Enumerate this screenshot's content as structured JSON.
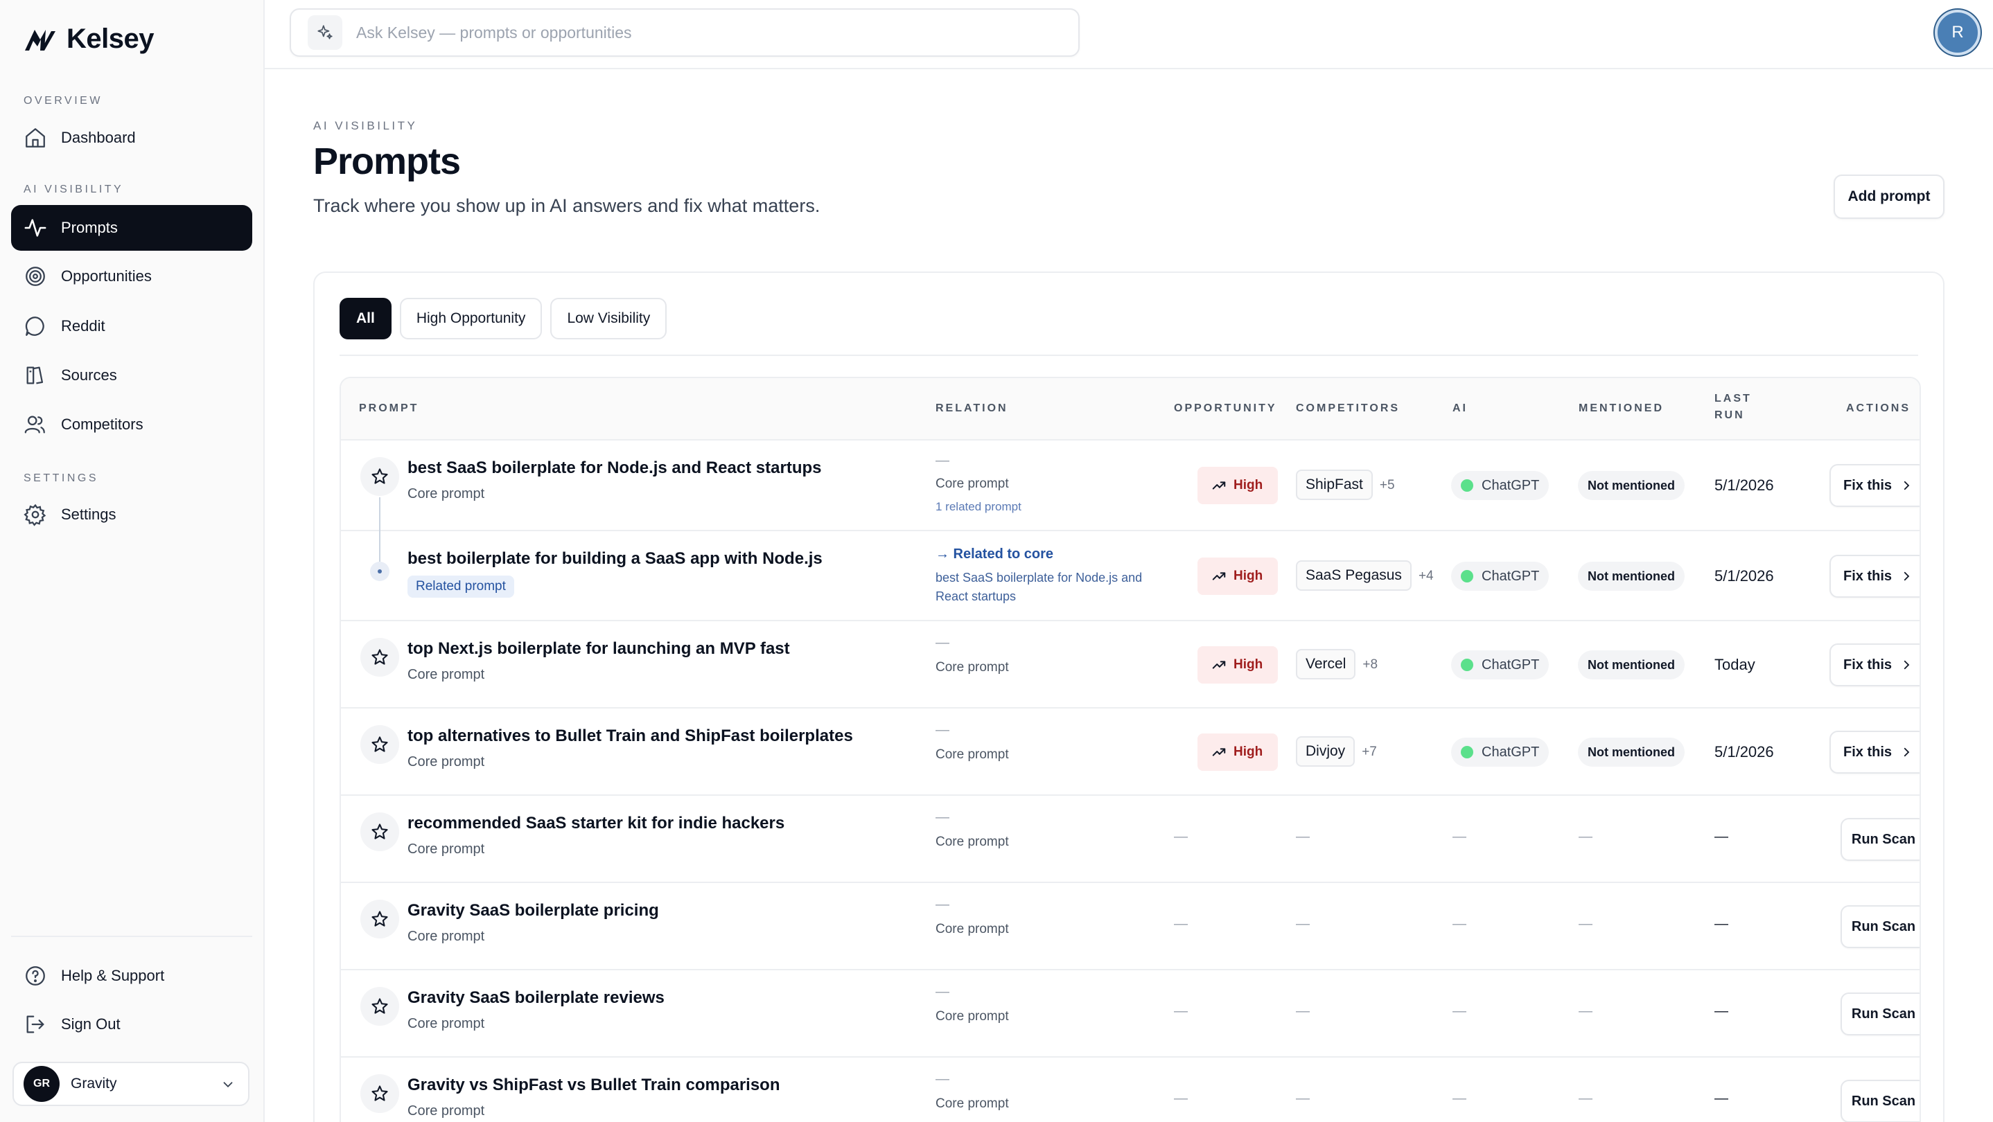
{
  "app": {
    "name": "Kelsey"
  },
  "sidebar": {
    "sections": [
      {
        "label": "OVERVIEW"
      },
      {
        "label": "AI VISIBILITY"
      },
      {
        "label": "SETTINGS"
      }
    ],
    "items": [
      {
        "label": "Dashboard",
        "icon": "home-icon"
      },
      {
        "label": "Prompts",
        "icon": "activity-icon",
        "active": true
      },
      {
        "label": "Opportunities",
        "icon": "target-icon"
      },
      {
        "label": "Reddit",
        "icon": "chat-bubble-icon"
      },
      {
        "label": "Sources",
        "icon": "book-icon"
      },
      {
        "label": "Competitors",
        "icon": "users-icon"
      },
      {
        "label": "Settings",
        "icon": "gear-icon"
      }
    ],
    "footer": [
      {
        "label": "Help & Support",
        "icon": "help-circle-icon"
      },
      {
        "label": "Sign Out",
        "icon": "sign-out-icon"
      }
    ],
    "workspace": {
      "initials": "GR",
      "name": "Gravity"
    }
  },
  "topbar": {
    "search_placeholder": "Ask Kelsey — prompts or opportunities",
    "user_initial": "R"
  },
  "header": {
    "eyebrow": "AI VISIBILITY",
    "title": "Prompts",
    "subtitle": "Track where you show up in AI answers and fix what matters.",
    "add_button": "Add prompt"
  },
  "tabs": [
    "All",
    "High Opportunity",
    "Low Visibility"
  ],
  "table": {
    "columns": {
      "prompt": "PROMPT",
      "relation": "RELATION",
      "opportunity": "OPPORTUNITY",
      "competitors": "COMPETITORS",
      "ai": "AI",
      "mentioned": "MENTIONED",
      "last_run_1": "LAST",
      "last_run_2": "RUN",
      "actions": "ACTIONS"
    },
    "rows": [
      {
        "title": "best SaaS boilerplate for Node.js and React startups",
        "sub": "Core prompt",
        "rel_dash": "—",
        "rel_label": "Core prompt",
        "rel_extra": "1 related prompt",
        "opportunity": "High",
        "competitor": "ShipFast",
        "competitor_more": "+5",
        "ai": "ChatGPT",
        "mentioned": "Not mentioned",
        "last_run": "5/1/2026",
        "action": "Fix this"
      },
      {
        "title": "best boilerplate for building a SaaS app with Node.js",
        "sub": "Related prompt",
        "rel_label": "→ Related to core",
        "rel_desc": "best SaaS boilerplate for Node.js and React startups",
        "opportunity": "High",
        "competitor": "SaaS Pegasus",
        "competitor_more": "+4",
        "ai": "ChatGPT",
        "mentioned": "Not mentioned",
        "last_run": "5/1/2026",
        "action": "Fix this"
      },
      {
        "title": "top Next.js boilerplate for launching an MVP fast",
        "sub": "Core prompt",
        "rel_dash": "—",
        "rel_label": "Core prompt",
        "opportunity": "High",
        "competitor": "Vercel",
        "competitor_more": "+8",
        "ai": "ChatGPT",
        "mentioned": "Not mentioned",
        "last_run": "Today",
        "action": "Fix this"
      },
      {
        "title": "top alternatives to Bullet Train and ShipFast boilerplates",
        "sub": "Core prompt",
        "rel_dash": "—",
        "rel_label": "Core prompt",
        "opportunity": "High",
        "competitor": "Divjoy",
        "competitor_more": "+7",
        "ai": "ChatGPT",
        "mentioned": "Not mentioned",
        "last_run": "5/1/2026",
        "action": "Fix this"
      },
      {
        "title": "recommended SaaS starter kit for indie hackers",
        "sub": "Core prompt",
        "rel_dash": "—",
        "rel_label": "Core prompt",
        "empty": "—",
        "action": "Run Scan"
      },
      {
        "title": "Gravity SaaS boilerplate pricing",
        "sub": "Core prompt",
        "rel_dash": "—",
        "rel_label": "Core prompt",
        "empty": "—",
        "action": "Run Scan"
      },
      {
        "title": "Gravity SaaS boilerplate reviews",
        "sub": "Core prompt",
        "rel_dash": "—",
        "rel_label": "Core prompt",
        "empty": "—",
        "action": "Run Scan"
      },
      {
        "title": "Gravity vs ShipFast vs Bullet Train comparison",
        "sub": "Core prompt",
        "rel_dash": "—",
        "rel_label": "Core prompt",
        "empty": "—",
        "action": "Run Scan"
      }
    ]
  },
  "colors": {
    "accent_dark": "#0b0f19",
    "high_badge_bg": "#fdecec",
    "high_badge_text": "#9f1d1d",
    "link_blue": "#2452a0"
  }
}
